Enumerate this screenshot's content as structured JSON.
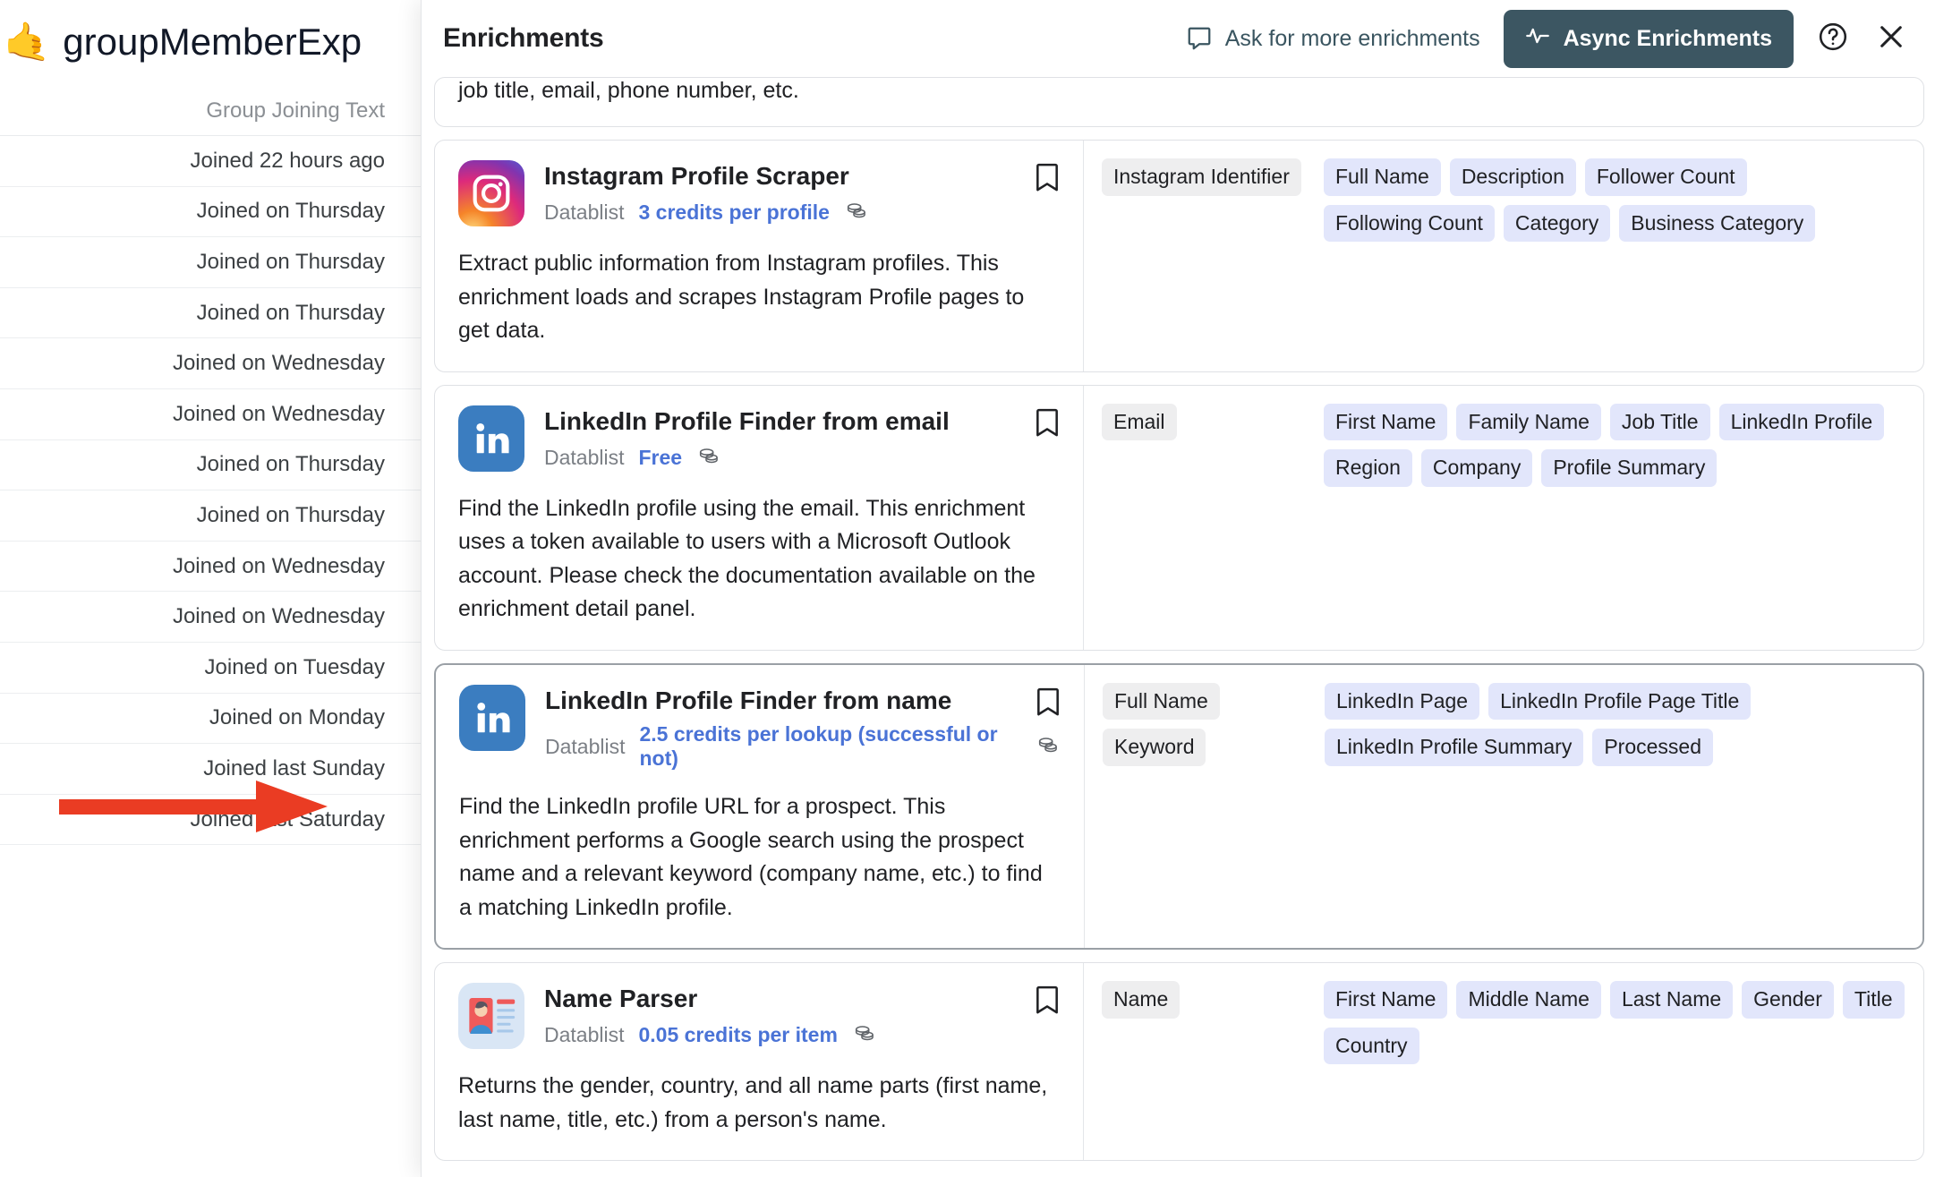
{
  "background": {
    "emoji": "🤙",
    "workspace_title": "groupMemberExp",
    "table": {
      "column_header": "Group Joining Text",
      "rows": [
        "Joined 22 hours ago",
        "Joined on Thursday",
        "Joined on Thursday",
        "Joined on Thursday",
        "Joined on Wednesday",
        "Joined on Wednesday",
        "Joined on Thursday",
        "Joined on Thursday",
        "Joined on Wednesday",
        "Joined on Wednesday",
        "Joined on Tuesday",
        "Joined on Monday",
        "Joined last Sunday",
        "Joined last Saturday"
      ]
    }
  },
  "panel": {
    "title": "Enrichments",
    "ask_label": "Ask for more enrichments",
    "async_label": "Async Enrichments",
    "accent_color": "#3c5662",
    "tag_input_color": "#eeeeef",
    "tag_output_color": "#e2e6fb",
    "price_color": "#4a73d6",
    "partial_card_text": "job title, email, phone number, etc.",
    "cards": [
      {
        "title": "Instagram Profile Scraper",
        "vendor": "Datablist",
        "price": "3 credits per profile",
        "description": "Extract public information from Instagram profiles. This enrichment loads and scrapes Instagram Profile pages to get data.",
        "logo": "instagram-logo",
        "inputs": [
          "Instagram Identifier"
        ],
        "outputs": [
          "Full Name",
          "Description",
          "Follower Count",
          "Following Count",
          "Category",
          "Business Category"
        ],
        "selected": false
      },
      {
        "title": "LinkedIn Profile Finder from email",
        "vendor": "Datablist",
        "price": "Free",
        "description": "Find the LinkedIn profile using the email. This enrichment uses a token available to users with a Microsoft Outlook account. Please check the documentation available on the enrichment detail panel.",
        "logo": "linkedin-logo",
        "inputs": [
          "Email"
        ],
        "outputs": [
          "First Name",
          "Family Name",
          "Job Title",
          "LinkedIn Profile",
          "Region",
          "Company",
          "Profile Summary"
        ],
        "selected": false
      },
      {
        "title": "LinkedIn Profile Finder from name",
        "vendor": "Datablist",
        "price": "2.5 credits per lookup (successful or not)",
        "description": "Find the LinkedIn profile URL for a prospect. This enrichment performs a Google search using the prospect name and a relevant keyword (company name, etc.) to find a matching LinkedIn profile.",
        "logo": "linkedin-logo",
        "inputs": [
          "Full Name",
          "Keyword"
        ],
        "outputs": [
          "LinkedIn Page",
          "LinkedIn Profile Page Title",
          "LinkedIn Profile Summary",
          "Processed"
        ],
        "selected": true
      },
      {
        "title": "Name Parser",
        "vendor": "Datablist",
        "price": "0.05 credits per item",
        "description": "Returns the gender, country, and all name parts (first name, last name, title, etc.) from a person's name.",
        "logo": "name-parser-logo",
        "inputs": [
          "Name"
        ],
        "outputs": [
          "First Name",
          "Middle Name",
          "Last Name",
          "Gender",
          "Title",
          "Country"
        ],
        "selected": false
      }
    ]
  }
}
